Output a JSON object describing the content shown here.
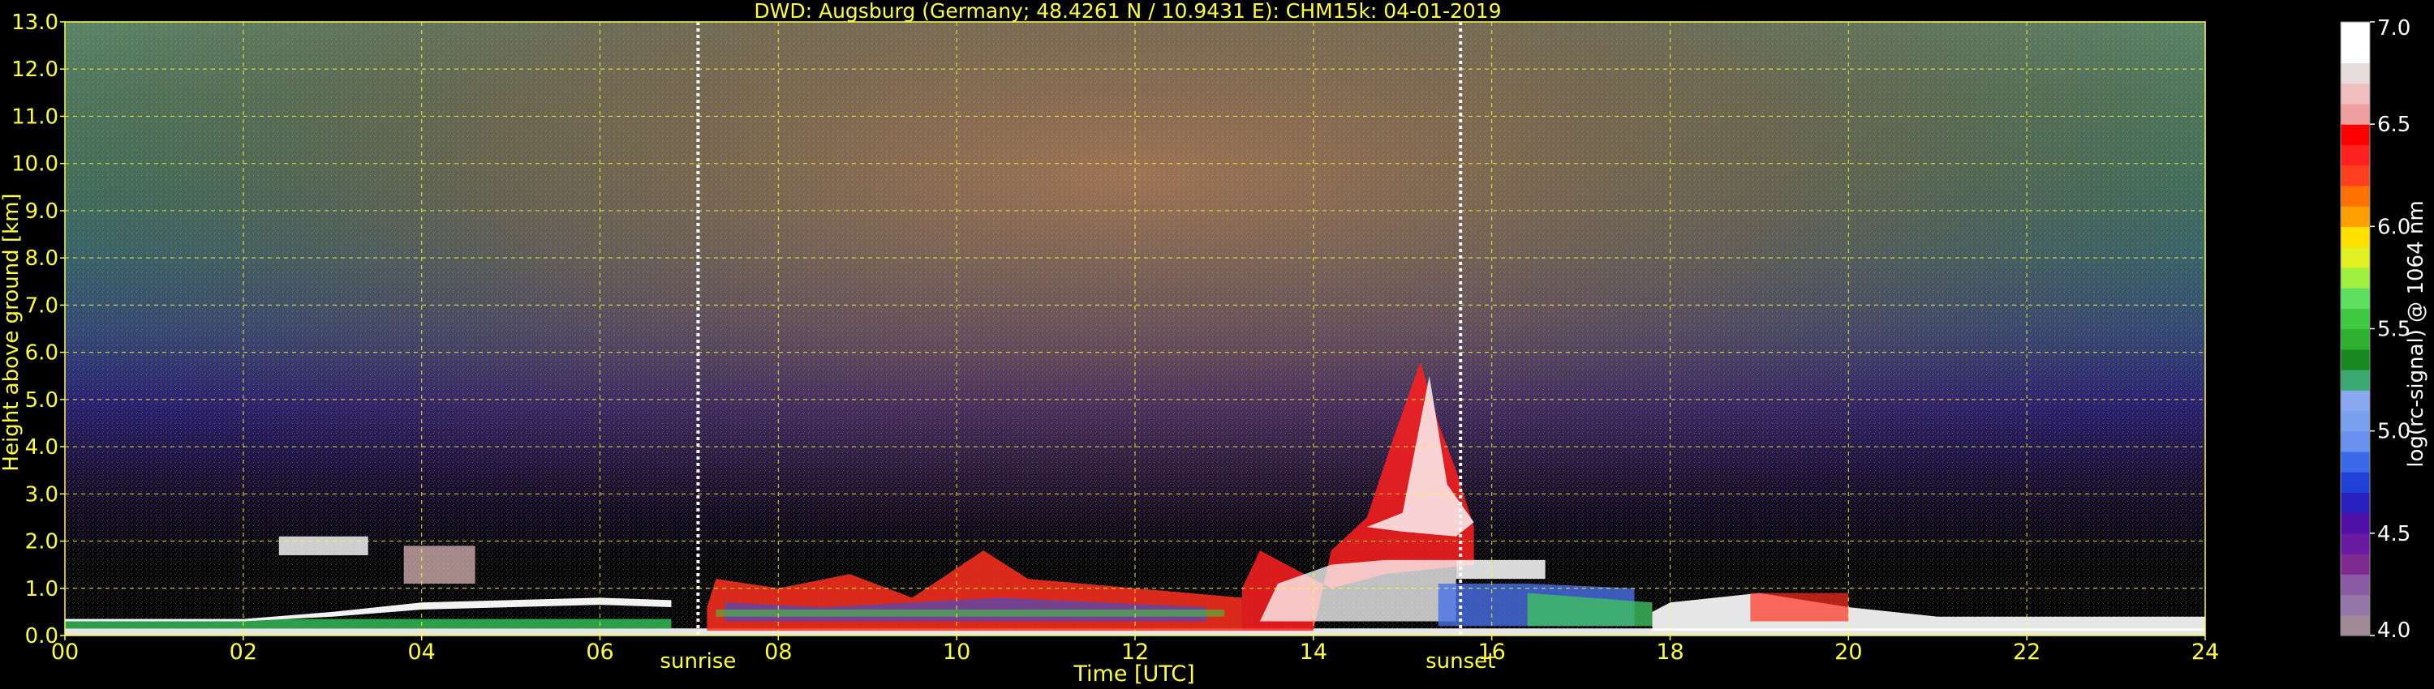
{
  "chart_data": {
    "type": "heatmap",
    "title": "DWD: Augsburg (Germany; 48.4261 N / 10.9431 E):    CHM15k: 04-01-2019",
    "xlabel": "Time [UTC]",
    "ylabel": "Height above ground [km]",
    "xlim": [
      0,
      24
    ],
    "ylim": [
      0,
      13
    ],
    "x_ticks": [
      {
        "value": 0,
        "label": "00"
      },
      {
        "value": 2,
        "label": "02"
      },
      {
        "value": 4,
        "label": "04"
      },
      {
        "value": 6,
        "label": "06"
      },
      {
        "value": 8,
        "label": "08"
      },
      {
        "value": 10,
        "label": "10"
      },
      {
        "value": 12,
        "label": "12"
      },
      {
        "value": 14,
        "label": "14"
      },
      {
        "value": 16,
        "label": "16"
      },
      {
        "value": 18,
        "label": "18"
      },
      {
        "value": 20,
        "label": "20"
      },
      {
        "value": 22,
        "label": "22"
      },
      {
        "value": 24,
        "label": "24"
      }
    ],
    "y_ticks": [
      {
        "value": 0,
        "label": "0.0"
      },
      {
        "value": 1,
        "label": "1.0"
      },
      {
        "value": 2,
        "label": "2.0"
      },
      {
        "value": 3,
        "label": "3.0"
      },
      {
        "value": 4,
        "label": "4.0"
      },
      {
        "value": 5,
        "label": "5.0"
      },
      {
        "value": 6,
        "label": "6.0"
      },
      {
        "value": 7,
        "label": "7.0"
      },
      {
        "value": 8,
        "label": "8.0"
      },
      {
        "value": 9,
        "label": "9.0"
      },
      {
        "value": 10,
        "label": "10.0"
      },
      {
        "value": 11,
        "label": "11.0"
      },
      {
        "value": 12,
        "label": "12.0"
      },
      {
        "value": 13,
        "label": "13.0"
      }
    ],
    "grid": true,
    "annotations": [
      {
        "label": "sunrise",
        "x": 7.1
      },
      {
        "label": "sunset",
        "x": 15.65
      }
    ],
    "colorbar": {
      "label": "log(rc-signal) @ 1064 nm",
      "range": [
        4.0,
        7.0
      ],
      "ticks": [
        {
          "value": 4.0,
          "label": "4.0"
        },
        {
          "value": 4.5,
          "label": "4.5"
        },
        {
          "value": 5.0,
          "label": "5.0"
        },
        {
          "value": 5.5,
          "label": "5.5"
        },
        {
          "value": 6.0,
          "label": "6.0"
        },
        {
          "value": 6.5,
          "label": "6.5"
        },
        {
          "value": 7.0,
          "label": "7.0"
        }
      ],
      "colors": [
        "#a08a96",
        "#9477a8",
        "#8a5aa4",
        "#7e2a90",
        "#6a1aa0",
        "#5010a8",
        "#2a20c0",
        "#2040d8",
        "#3a6ae8",
        "#6a90f0",
        "#7aa0f0",
        "#8aa8f0",
        "#3aa870",
        "#188820",
        "#30b030",
        "#40c840",
        "#60e060",
        "#a0f040",
        "#e0f020",
        "#ffe000",
        "#ffa000",
        "#ff7000",
        "#ff4020",
        "#ff2020",
        "#ff0000",
        "#f0a0a0",
        "#f0c0c0",
        "#e8dcdc",
        "#ffffff",
        "#ffffff"
      ]
    }
  }
}
